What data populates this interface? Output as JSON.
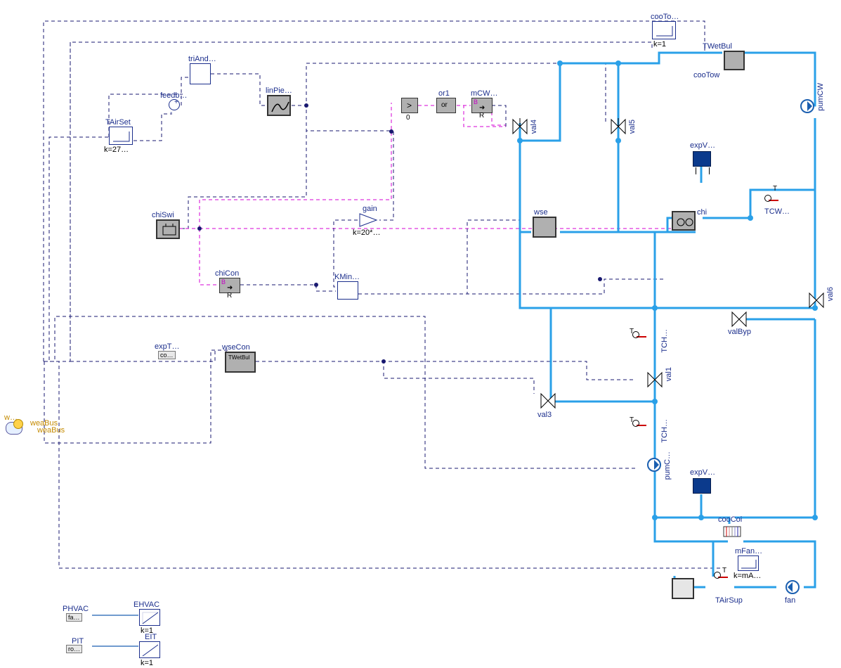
{
  "labels": {
    "w": "w…",
    "weaBus1": "weaBus",
    "weaBus2": "weaBus",
    "weaData": "w…",
    "triAnd": "triAnd…",
    "feedb": "feedb…",
    "TAirSet": "TAirSet",
    "TAirSet_k": "k=27…",
    "linPie": "linPie…",
    "or1": "or1",
    "greater0_zero": "0",
    "mCW": "mCW…",
    "cooTo": "cooTo…",
    "cooTo_k": "k=1",
    "TWetBul": "TWetBul",
    "cooTow": "cooTow",
    "pumCW": "pumCW",
    "chiSwi": "chiSwi",
    "gain": "gain",
    "gain_k": "k=20*…",
    "chiCon": "chiCon",
    "chiCon_R": "R",
    "chiCon_B": "B",
    "KMin": "KMin…",
    "expT": "expT…",
    "expT_co": "co…",
    "wseCon": "wseCon",
    "wseCon_inner": "TWetBul",
    "wse": "wse",
    "val4": "val4",
    "val5": "val5",
    "expV1": "expV…",
    "chi": "chi",
    "TCW": "TCW…",
    "val6": "val6",
    "valByp": "valByp",
    "TCH1": "TCH…",
    "val1": "val1",
    "val3": "val3",
    "TCH2": "TCH…",
    "pumC": "pumC…",
    "expV2": "expV…",
    "cooCoi": "cooCoi",
    "mFan": "mFan…",
    "mFan_k": "k=mA…",
    "TAirSup": "TAirSup",
    "fan": "fan",
    "PHVAC": "PHVAC",
    "PHVAC_fa": "fa…",
    "EHVAC": "EHVAC",
    "PIT": "PIT",
    "PIT_ro": "ro…",
    "EIT": "EIT",
    "k1a": "k=1",
    "k1b": "k=1",
    "BtoR_arrow": "➜"
  }
}
